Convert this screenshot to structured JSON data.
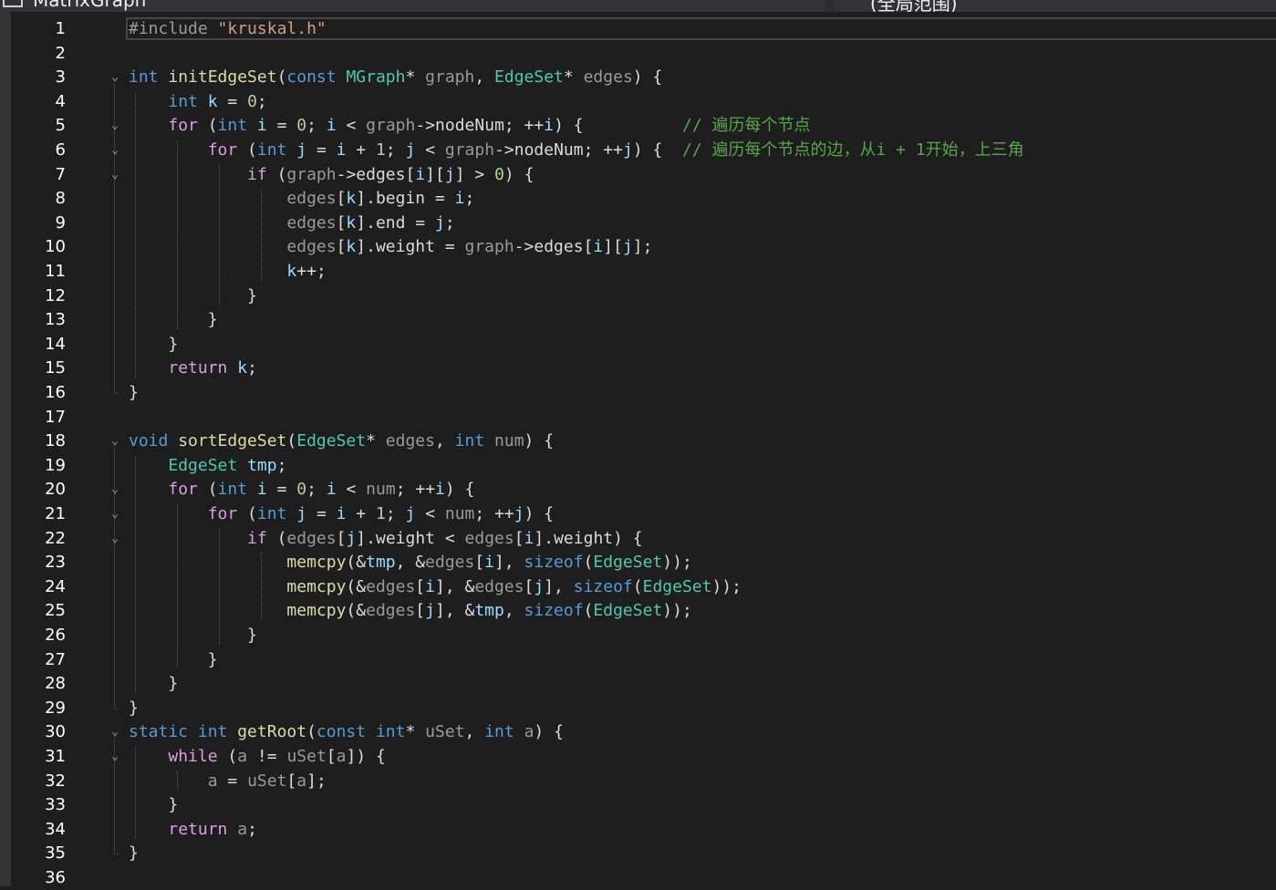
{
  "topbar": {
    "project_dropdown": "MatrixGraph",
    "scope_dropdown": "(全局范围)"
  },
  "editor": {
    "lines": [
      {
        "n": "1",
        "fold": "",
        "current": true,
        "tokens": [
          [
            "pre",
            "#include "
          ],
          [
            "str",
            "\"kruskal.h\""
          ]
        ]
      },
      {
        "n": "2",
        "fold": "",
        "tokens": []
      },
      {
        "n": "3",
        "fold": "⌄",
        "tokens": [
          [
            "kw",
            "int "
          ],
          [
            "fn",
            "initEdgeSet"
          ],
          [
            "plain",
            "("
          ],
          [
            "kw",
            "const "
          ],
          [
            "type",
            "MGraph"
          ],
          [
            "plain",
            "* "
          ],
          [
            "param",
            "graph"
          ],
          [
            "plain",
            ", "
          ],
          [
            "type",
            "EdgeSet"
          ],
          [
            "plain",
            "* "
          ],
          [
            "param",
            "edges"
          ],
          [
            "plain",
            ") {"
          ]
        ]
      },
      {
        "n": "4",
        "fold": "",
        "tokens": [
          [
            "plain",
            "    "
          ],
          [
            "kw",
            "int "
          ],
          [
            "local",
            "k"
          ],
          [
            "plain",
            " = "
          ],
          [
            "num",
            "0"
          ],
          [
            "plain",
            ";"
          ]
        ]
      },
      {
        "n": "5",
        "fold": "⌄",
        "tokens": [
          [
            "plain",
            "    "
          ],
          [
            "ctrl",
            "for"
          ],
          [
            "plain",
            " ("
          ],
          [
            "kw",
            "int "
          ],
          [
            "local",
            "i"
          ],
          [
            "plain",
            " = "
          ],
          [
            "num",
            "0"
          ],
          [
            "plain",
            "; "
          ],
          [
            "local",
            "i"
          ],
          [
            "plain",
            " < "
          ],
          [
            "param",
            "graph"
          ],
          [
            "plain",
            "->"
          ],
          [
            "fld",
            "nodeNum"
          ],
          [
            "plain",
            "; ++"
          ],
          [
            "local",
            "i"
          ],
          [
            "plain",
            ") {          "
          ],
          [
            "cm",
            "// 遍历每个节点"
          ]
        ]
      },
      {
        "n": "6",
        "fold": "⌄",
        "tokens": [
          [
            "plain",
            "        "
          ],
          [
            "ctrl",
            "for"
          ],
          [
            "plain",
            " ("
          ],
          [
            "kw",
            "int "
          ],
          [
            "local",
            "j"
          ],
          [
            "plain",
            " = "
          ],
          [
            "local",
            "i"
          ],
          [
            "plain",
            " + "
          ],
          [
            "num",
            "1"
          ],
          [
            "plain",
            "; "
          ],
          [
            "local",
            "j"
          ],
          [
            "plain",
            " < "
          ],
          [
            "param",
            "graph"
          ],
          [
            "plain",
            "->"
          ],
          [
            "fld",
            "nodeNum"
          ],
          [
            "plain",
            "; ++"
          ],
          [
            "local",
            "j"
          ],
          [
            "plain",
            ") {  "
          ],
          [
            "cm",
            "// 遍历每个节点的边，从i + 1开始，上三角"
          ]
        ]
      },
      {
        "n": "7",
        "fold": "⌄",
        "tokens": [
          [
            "plain",
            "            "
          ],
          [
            "ctrl",
            "if"
          ],
          [
            "plain",
            " ("
          ],
          [
            "param",
            "graph"
          ],
          [
            "plain",
            "->"
          ],
          [
            "fld",
            "edges"
          ],
          [
            "plain",
            "["
          ],
          [
            "local",
            "i"
          ],
          [
            "plain",
            "]["
          ],
          [
            "local",
            "j"
          ],
          [
            "plain",
            "] > "
          ],
          [
            "num",
            "0"
          ],
          [
            "plain",
            ") {"
          ]
        ]
      },
      {
        "n": "8",
        "fold": "",
        "tokens": [
          [
            "plain",
            "                "
          ],
          [
            "param",
            "edges"
          ],
          [
            "plain",
            "["
          ],
          [
            "local",
            "k"
          ],
          [
            "plain",
            "]."
          ],
          [
            "fld",
            "begin"
          ],
          [
            "plain",
            " = "
          ],
          [
            "local",
            "i"
          ],
          [
            "plain",
            ";"
          ]
        ]
      },
      {
        "n": "9",
        "fold": "",
        "tokens": [
          [
            "plain",
            "                "
          ],
          [
            "param",
            "edges"
          ],
          [
            "plain",
            "["
          ],
          [
            "local",
            "k"
          ],
          [
            "plain",
            "]."
          ],
          [
            "fld",
            "end"
          ],
          [
            "plain",
            " = "
          ],
          [
            "local",
            "j"
          ],
          [
            "plain",
            ";"
          ]
        ]
      },
      {
        "n": "10",
        "fold": "",
        "tokens": [
          [
            "plain",
            "                "
          ],
          [
            "param",
            "edges"
          ],
          [
            "plain",
            "["
          ],
          [
            "local",
            "k"
          ],
          [
            "plain",
            "]."
          ],
          [
            "fld",
            "weight"
          ],
          [
            "plain",
            " = "
          ],
          [
            "param",
            "graph"
          ],
          [
            "plain",
            "->"
          ],
          [
            "fld",
            "edges"
          ],
          [
            "plain",
            "["
          ],
          [
            "local",
            "i"
          ],
          [
            "plain",
            "]["
          ],
          [
            "local",
            "j"
          ],
          [
            "plain",
            "];"
          ]
        ]
      },
      {
        "n": "11",
        "fold": "",
        "tokens": [
          [
            "plain",
            "                "
          ],
          [
            "local",
            "k"
          ],
          [
            "plain",
            "++;"
          ]
        ]
      },
      {
        "n": "12",
        "fold": "",
        "tokens": [
          [
            "plain",
            "            }"
          ]
        ]
      },
      {
        "n": "13",
        "fold": "",
        "tokens": [
          [
            "plain",
            "        }"
          ]
        ]
      },
      {
        "n": "14",
        "fold": "",
        "tokens": [
          [
            "plain",
            "    }"
          ]
        ]
      },
      {
        "n": "15",
        "fold": "",
        "tokens": [
          [
            "plain",
            "    "
          ],
          [
            "ctrl",
            "return "
          ],
          [
            "local",
            "k"
          ],
          [
            "plain",
            ";"
          ]
        ]
      },
      {
        "n": "16",
        "fold": "",
        "tokens": [
          [
            "plain",
            "}"
          ]
        ]
      },
      {
        "n": "17",
        "fold": "",
        "tokens": []
      },
      {
        "n": "18",
        "fold": "⌄",
        "tokens": [
          [
            "kw",
            "void "
          ],
          [
            "fn",
            "sortEdgeSet"
          ],
          [
            "plain",
            "("
          ],
          [
            "type",
            "EdgeSet"
          ],
          [
            "plain",
            "* "
          ],
          [
            "param",
            "edges"
          ],
          [
            "plain",
            ", "
          ],
          [
            "kw",
            "int "
          ],
          [
            "param",
            "num"
          ],
          [
            "plain",
            ") {"
          ]
        ]
      },
      {
        "n": "19",
        "fold": "",
        "tokens": [
          [
            "plain",
            "    "
          ],
          [
            "type",
            "EdgeSet "
          ],
          [
            "local",
            "tmp"
          ],
          [
            "plain",
            ";"
          ]
        ]
      },
      {
        "n": "20",
        "fold": "⌄",
        "tokens": [
          [
            "plain",
            "    "
          ],
          [
            "ctrl",
            "for"
          ],
          [
            "plain",
            " ("
          ],
          [
            "kw",
            "int "
          ],
          [
            "local",
            "i"
          ],
          [
            "plain",
            " = "
          ],
          [
            "num",
            "0"
          ],
          [
            "plain",
            "; "
          ],
          [
            "local",
            "i"
          ],
          [
            "plain",
            " < "
          ],
          [
            "param",
            "num"
          ],
          [
            "plain",
            "; ++"
          ],
          [
            "local",
            "i"
          ],
          [
            "plain",
            ") {"
          ]
        ]
      },
      {
        "n": "21",
        "fold": "⌄",
        "tokens": [
          [
            "plain",
            "        "
          ],
          [
            "ctrl",
            "for"
          ],
          [
            "plain",
            " ("
          ],
          [
            "kw",
            "int "
          ],
          [
            "local",
            "j"
          ],
          [
            "plain",
            " = "
          ],
          [
            "local",
            "i"
          ],
          [
            "plain",
            " + "
          ],
          [
            "num",
            "1"
          ],
          [
            "plain",
            "; "
          ],
          [
            "local",
            "j"
          ],
          [
            "plain",
            " < "
          ],
          [
            "param",
            "num"
          ],
          [
            "plain",
            "; ++"
          ],
          [
            "local",
            "j"
          ],
          [
            "plain",
            ") {"
          ]
        ]
      },
      {
        "n": "22",
        "fold": "⌄",
        "tokens": [
          [
            "plain",
            "            "
          ],
          [
            "ctrl",
            "if"
          ],
          [
            "plain",
            " ("
          ],
          [
            "param",
            "edges"
          ],
          [
            "plain",
            "["
          ],
          [
            "local",
            "j"
          ],
          [
            "plain",
            "]."
          ],
          [
            "fld",
            "weight"
          ],
          [
            "plain",
            " < "
          ],
          [
            "param",
            "edges"
          ],
          [
            "plain",
            "["
          ],
          [
            "local",
            "i"
          ],
          [
            "plain",
            "]."
          ],
          [
            "fld",
            "weight"
          ],
          [
            "plain",
            ") {"
          ]
        ]
      },
      {
        "n": "23",
        "fold": "",
        "tokens": [
          [
            "plain",
            "                "
          ],
          [
            "fn",
            "memcpy"
          ],
          [
            "plain",
            "(&"
          ],
          [
            "local",
            "tmp"
          ],
          [
            "plain",
            ", &"
          ],
          [
            "param",
            "edges"
          ],
          [
            "plain",
            "["
          ],
          [
            "local",
            "i"
          ],
          [
            "plain",
            "], "
          ],
          [
            "kw",
            "sizeof"
          ],
          [
            "plain",
            "("
          ],
          [
            "type",
            "EdgeSet"
          ],
          [
            "plain",
            "));"
          ]
        ]
      },
      {
        "n": "24",
        "fold": "",
        "tokens": [
          [
            "plain",
            "                "
          ],
          [
            "fn",
            "memcpy"
          ],
          [
            "plain",
            "(&"
          ],
          [
            "param",
            "edges"
          ],
          [
            "plain",
            "["
          ],
          [
            "local",
            "i"
          ],
          [
            "plain",
            "], &"
          ],
          [
            "param",
            "edges"
          ],
          [
            "plain",
            "["
          ],
          [
            "local",
            "j"
          ],
          [
            "plain",
            "], "
          ],
          [
            "kw",
            "sizeof"
          ],
          [
            "plain",
            "("
          ],
          [
            "type",
            "EdgeSet"
          ],
          [
            "plain",
            "));"
          ]
        ]
      },
      {
        "n": "25",
        "fold": "",
        "tokens": [
          [
            "plain",
            "                "
          ],
          [
            "fn",
            "memcpy"
          ],
          [
            "plain",
            "(&"
          ],
          [
            "param",
            "edges"
          ],
          [
            "plain",
            "["
          ],
          [
            "local",
            "j"
          ],
          [
            "plain",
            "], &"
          ],
          [
            "local",
            "tmp"
          ],
          [
            "plain",
            ", "
          ],
          [
            "kw",
            "sizeof"
          ],
          [
            "plain",
            "("
          ],
          [
            "type",
            "EdgeSet"
          ],
          [
            "plain",
            "));"
          ]
        ]
      },
      {
        "n": "26",
        "fold": "",
        "tokens": [
          [
            "plain",
            "            }"
          ]
        ]
      },
      {
        "n": "27",
        "fold": "",
        "tokens": [
          [
            "plain",
            "        }"
          ]
        ]
      },
      {
        "n": "28",
        "fold": "",
        "tokens": [
          [
            "plain",
            "    }"
          ]
        ]
      },
      {
        "n": "29",
        "fold": "",
        "tokens": [
          [
            "plain",
            "}"
          ]
        ]
      },
      {
        "n": "30",
        "fold": "⌄",
        "tokens": [
          [
            "kw",
            "static "
          ],
          [
            "kw",
            "int "
          ],
          [
            "fn",
            "getRoot"
          ],
          [
            "plain",
            "("
          ],
          [
            "kw",
            "const "
          ],
          [
            "kw",
            "int"
          ],
          [
            "plain",
            "* "
          ],
          [
            "param",
            "uSet"
          ],
          [
            "plain",
            ", "
          ],
          [
            "kw",
            "int "
          ],
          [
            "param",
            "a"
          ],
          [
            "plain",
            ") {"
          ]
        ]
      },
      {
        "n": "31",
        "fold": "⌄",
        "tokens": [
          [
            "plain",
            "    "
          ],
          [
            "ctrl",
            "while"
          ],
          [
            "plain",
            " ("
          ],
          [
            "param",
            "a"
          ],
          [
            "plain",
            " != "
          ],
          [
            "param",
            "uSet"
          ],
          [
            "plain",
            "["
          ],
          [
            "param",
            "a"
          ],
          [
            "plain",
            "]) {"
          ]
        ]
      },
      {
        "n": "32",
        "fold": "",
        "tokens": [
          [
            "plain",
            "        "
          ],
          [
            "param",
            "a"
          ],
          [
            "plain",
            " = "
          ],
          [
            "param",
            "uSet"
          ],
          [
            "plain",
            "["
          ],
          [
            "param",
            "a"
          ],
          [
            "plain",
            "];"
          ]
        ]
      },
      {
        "n": "33",
        "fold": "",
        "tokens": [
          [
            "plain",
            "    }"
          ]
        ]
      },
      {
        "n": "34",
        "fold": "",
        "tokens": [
          [
            "plain",
            "    "
          ],
          [
            "ctrl",
            "return "
          ],
          [
            "param",
            "a"
          ],
          [
            "plain",
            ";"
          ]
        ]
      },
      {
        "n": "35",
        "fold": "",
        "tokens": [
          [
            "plain",
            "}"
          ]
        ]
      },
      {
        "n": "36",
        "fold": "",
        "tokens": []
      }
    ]
  }
}
